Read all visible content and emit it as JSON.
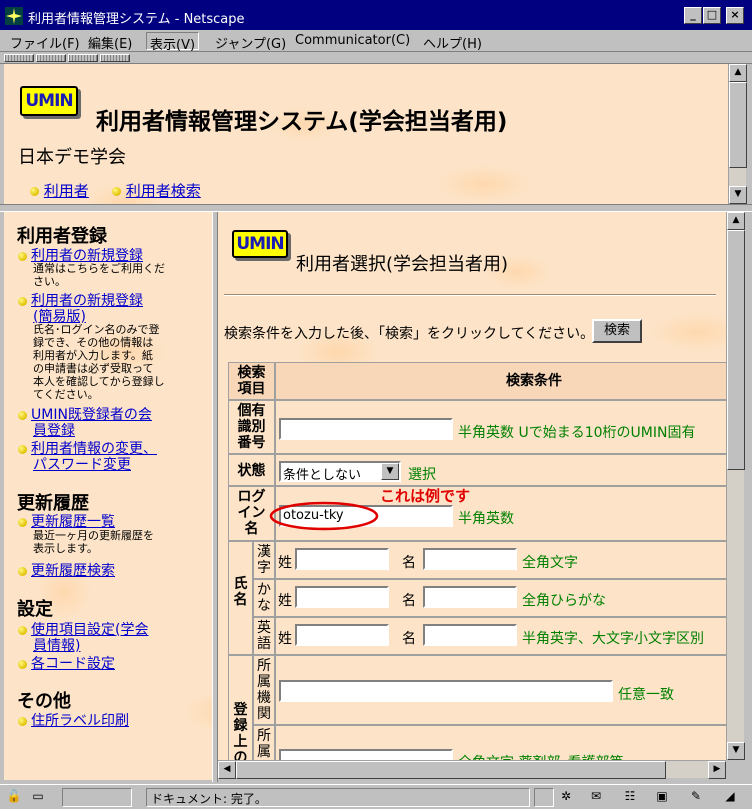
{
  "window": {
    "title": "利用者情報管理システム - Netscape"
  },
  "menu": [
    "ファイル(F)",
    "編集(E)",
    "表示(V)",
    "ジャンプ(G)",
    "Communicator(C)",
    "ヘルプ(H)"
  ],
  "logo_text": "UMIN",
  "top": {
    "title": "利用者情報管理システム(学会担当者用)",
    "society": "日本デモ学会",
    "links": [
      "利用者",
      "利用者検索"
    ]
  },
  "left": {
    "sections": [
      {
        "title": "利用者登録",
        "items": [
          {
            "label": "利用者の新規登録",
            "note": [
              "通常はこちらをご利用くだ",
              "さい。"
            ]
          },
          {
            "label": [
              "利用者の新規登録",
              "(簡易版)"
            ],
            "note": [
              "氏名･ログイン名のみで登",
              "録でき、その他の情報は",
              "利用者が入力します。紙",
              "の申請書は必ず受取って",
              "本人を確認してから登録し",
              "てください。"
            ]
          },
          {
            "label": [
              "UMIN既登録者の会",
              "員登録"
            ]
          },
          {
            "label": [
              "利用者情報の変更、",
              "パスワード変更"
            ]
          }
        ]
      },
      {
        "title": "更新履歴",
        "items": [
          {
            "label": "更新履歴一覧",
            "note": [
              "最近一ヶ月の更新履歴を",
              "表示します。"
            ]
          },
          {
            "label": "更新履歴検索"
          }
        ]
      },
      {
        "title": "設定",
        "items": [
          {
            "label": [
              "使用項目設定(学会",
              "員情報)"
            ]
          },
          {
            "label": "各コード設定"
          }
        ]
      },
      {
        "title": "その他",
        "items": [
          {
            "label": "住所ラベル印刷"
          }
        ]
      }
    ]
  },
  "main": {
    "title": "利用者選択(学会担当者用)",
    "instruction": "検索条件を入力した後、「検索」をクリックしてください。",
    "search_button": "検索",
    "table": {
      "col1_header": [
        "検索",
        "項目"
      ],
      "col2_header": "検索条件",
      "rows": {
        "id": {
          "label": [
            "個有",
            "識別",
            "番号"
          ],
          "hint": "半角英数 Uで始まる10桁のUMIN固有"
        },
        "status": {
          "label": "状態",
          "select_value": "条件としない",
          "hint": "選択"
        },
        "login": {
          "label": [
            "ログ",
            "イン",
            "名"
          ],
          "value": "otozu-tky",
          "hint": "半角英数",
          "annotation": "これは例です"
        },
        "name": {
          "label": [
            "氏",
            "名"
          ],
          "kanji": {
            "label": [
              "漢",
              "字"
            ],
            "sei": "姓",
            "mei": "名",
            "hint": "全角文字"
          },
          "kana": {
            "label": [
              "か",
              "な"
            ],
            "sei": "姓",
            "mei": "名",
            "hint": "全角ひらがな"
          },
          "eigo": {
            "label": [
              "英",
              "語"
            ],
            "sei": "姓",
            "mei": "名",
            "hint": "半角英字、大文字小文字区別"
          }
        },
        "registered": {
          "label": [
            "登",
            "録",
            "上",
            "の"
          ],
          "org": {
            "label": [
              "所",
              "属",
              "機",
              "関"
            ],
            "hint": "任意一致"
          },
          "dept": {
            "label": [
              "所",
              "属"
            ],
            "hint": "全角文字 薬剤部･看護部等"
          }
        }
      }
    }
  },
  "status": {
    "text": "ドキュメント: 完了。"
  },
  "colors": {
    "titlebar": "#000080",
    "annotation": "#e00000",
    "hint": "#008000",
    "logo": "#ffff00"
  }
}
